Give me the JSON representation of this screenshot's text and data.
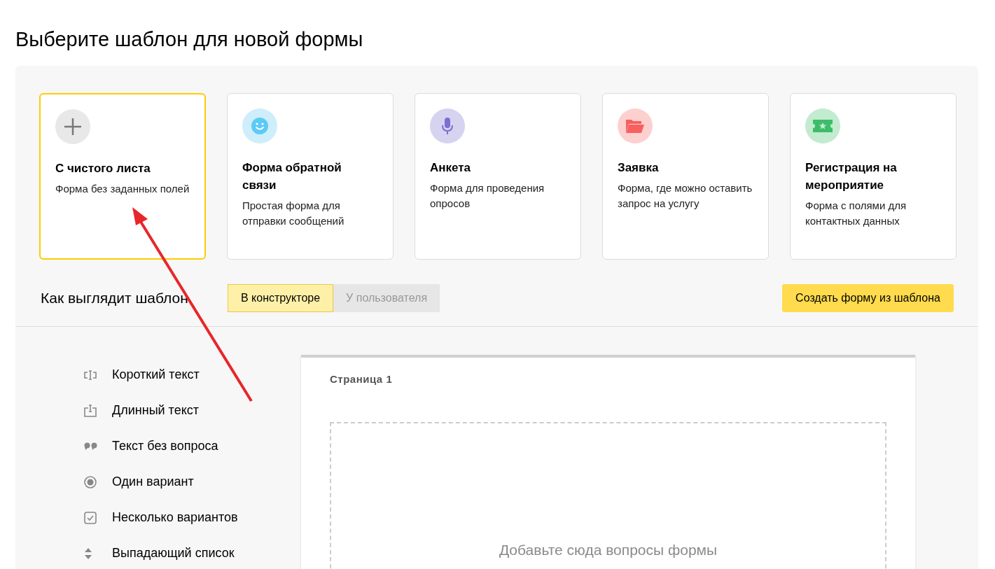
{
  "title": "Выберите шаблон для новой формы",
  "templates": [
    {
      "kind": "plus",
      "title": "С чистого листа",
      "description": "Форма без заданных полей",
      "selected": true
    },
    {
      "kind": "smile",
      "title": "Форма обратной связи",
      "description": "Простая форма для отправки сообщений",
      "selected": false
    },
    {
      "kind": "mic",
      "title": "Анкета",
      "description": "Форма для проведения опросов",
      "selected": false
    },
    {
      "kind": "folder",
      "title": "Заявка",
      "description": "Форма, где можно оставить запрос на услугу",
      "selected": false
    },
    {
      "kind": "ticket",
      "title": "Регистрация на мероприятие",
      "description": "Форма с полями для контактных данных",
      "selected": false
    }
  ],
  "preview_label": "Как выглядит шаблон",
  "view_tabs": [
    {
      "label": "В конструкторе",
      "selected": true
    },
    {
      "label": "У пользователя",
      "selected": false
    }
  ],
  "create_button": "Создать форму из шаблона",
  "question_types": [
    {
      "kind": "short",
      "label": "Короткий текст"
    },
    {
      "kind": "long",
      "label": "Длинный текст"
    },
    {
      "kind": "quote",
      "label": "Текст без вопроса"
    },
    {
      "kind": "radio",
      "label": "Один вариант"
    },
    {
      "kind": "checkbox",
      "label": "Несколько вариантов"
    },
    {
      "kind": "dropdown",
      "label": "Выпадающий список"
    }
  ],
  "page": {
    "title": "Страница 1",
    "drop_hint": "Добавьте сюда вопросы формы"
  }
}
